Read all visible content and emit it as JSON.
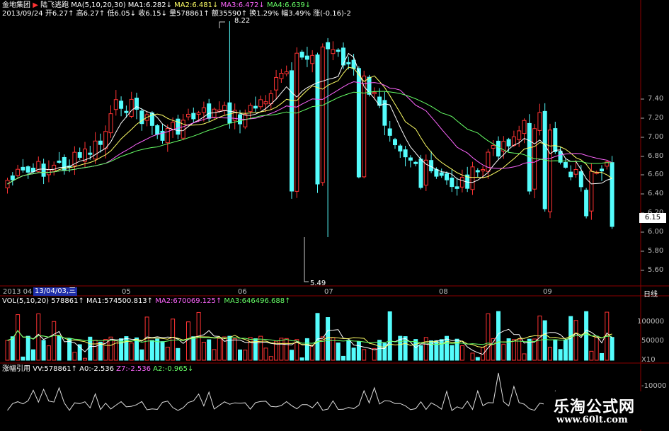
{
  "header": {
    "stock_name": "金地集团",
    "indicator_name": "陆飞逃跑",
    "date": "2013/09/24",
    "line1": [
      {
        "text": "MA(5,10,20,30)",
        "color": "#ffffff"
      },
      {
        "text": "MA1:6.282↓",
        "color": "#ffffff"
      },
      {
        "text": "MA2:6.481↓",
        "color": "#ffff66"
      },
      {
        "text": "MA3:6.472↓",
        "color": "#ff66ff"
      },
      {
        "text": "MA4:6.639↓",
        "color": "#66ff66"
      }
    ],
    "line2": [
      {
        "text": "开6.27↑",
        "color": "#ffffff"
      },
      {
        "text": "高6.27↑",
        "color": "#ffffff"
      },
      {
        "text": "低6.05↓",
        "color": "#ffffff"
      },
      {
        "text": "收6.15↓",
        "color": "#ffffff"
      },
      {
        "text": "量578861↑",
        "color": "#ffffff"
      },
      {
        "text": "额35590↑",
        "color": "#ffffff"
      },
      {
        "text": "换1.29%",
        "color": "#ffffff"
      },
      {
        "text": "幅3.49%",
        "color": "#ffffff"
      },
      {
        "text": "涨(-0.16)-2",
        "color": "#ffffff"
      }
    ]
  },
  "price_axis": {
    "labels": [
      "7.40",
      "7.20",
      "7.00",
      "6.80",
      "6.60",
      "6.40",
      "6.20",
      "6.00",
      "5.80",
      "5.60"
    ],
    "current_price_badge": "6.15"
  },
  "annotations": {
    "high": "8.22",
    "low": "5.49"
  },
  "time_axis": {
    "prefix": "2013 04",
    "cursor_date": "13/04/03,三",
    "months": [
      "05",
      "06",
      "07",
      "08",
      "09"
    ],
    "period_button": "日线"
  },
  "volume_panel": {
    "title": "VOL(5,10,20)",
    "items": [
      {
        "text": "578861↑",
        "color": "#ffffff"
      },
      {
        "text": "MA1:574500.813↑",
        "color": "#ffffff"
      },
      {
        "text": "MA2:670069.125↑",
        "color": "#ff66ff"
      },
      {
        "text": "MA3:646496.688↑",
        "color": "#66ff66"
      }
    ],
    "axis_labels": [
      "100000",
      "50000"
    ],
    "unit": "X10"
  },
  "indicator_panel": {
    "title": "涨幅引用",
    "items": [
      {
        "text": "VV:578861↑",
        "color": "#ffffff"
      },
      {
        "text": "A0:-2.536",
        "color": "#ffffff"
      },
      {
        "text": "Z7:-2.536",
        "color": "#ff66ff"
      },
      {
        "text": "A2:-0.965↓",
        "color": "#66ff66"
      }
    ],
    "axis_label": "-10000"
  },
  "watermark": {
    "title": "乐淘公式网",
    "url": "www.60lt.com"
  },
  "colors": {
    "up": "#ff3333",
    "down": "#54fcfc",
    "ma5": "#ffffff",
    "ma10": "#ffff66",
    "ma20": "#ff66ff",
    "ma30": "#66ff66",
    "grid": "#8b0000"
  }
}
